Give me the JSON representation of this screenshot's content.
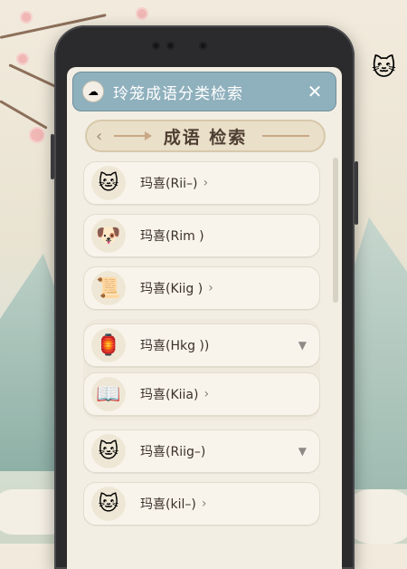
{
  "app": {
    "title": "玲笼成语分类检索",
    "close_symbol": "✕"
  },
  "banner": {
    "title": "成语 检索",
    "left_chevron": "‹"
  },
  "items": [
    {
      "label": "玛喜(Rii–)",
      "has_chevron": true,
      "icon": "cat-icon",
      "glyph": "🐱",
      "dropdown": false
    },
    {
      "label": "玛喜(Rim )",
      "has_chevron": false,
      "icon": "puppy-icon",
      "glyph": "🐶",
      "dropdown": false
    },
    {
      "label": "玛喜(Kiig )",
      "has_chevron": true,
      "icon": "scroll-book-icon",
      "glyph": "📜",
      "dropdown": false
    },
    {
      "label": "玛喜(Hkg ))",
      "has_chevron": true,
      "icon": "lantern-icon",
      "glyph": "🏮",
      "dropdown": true
    },
    {
      "label": "玛喜(Kiia)",
      "has_chevron": true,
      "icon": "open-book-icon",
      "glyph": "📖",
      "dropdown": false
    },
    {
      "label": "玛喜(Riig–)",
      "has_chevron": false,
      "icon": "cat-face-icon",
      "glyph": "🐱",
      "dropdown": true
    },
    {
      "label": "玛喜(kil–)",
      "has_chevron": true,
      "icon": "cat-girl-icon",
      "glyph": "🐱",
      "dropdown": false
    }
  ],
  "symbols": {
    "chevron": "›",
    "dropdown": "▼"
  }
}
